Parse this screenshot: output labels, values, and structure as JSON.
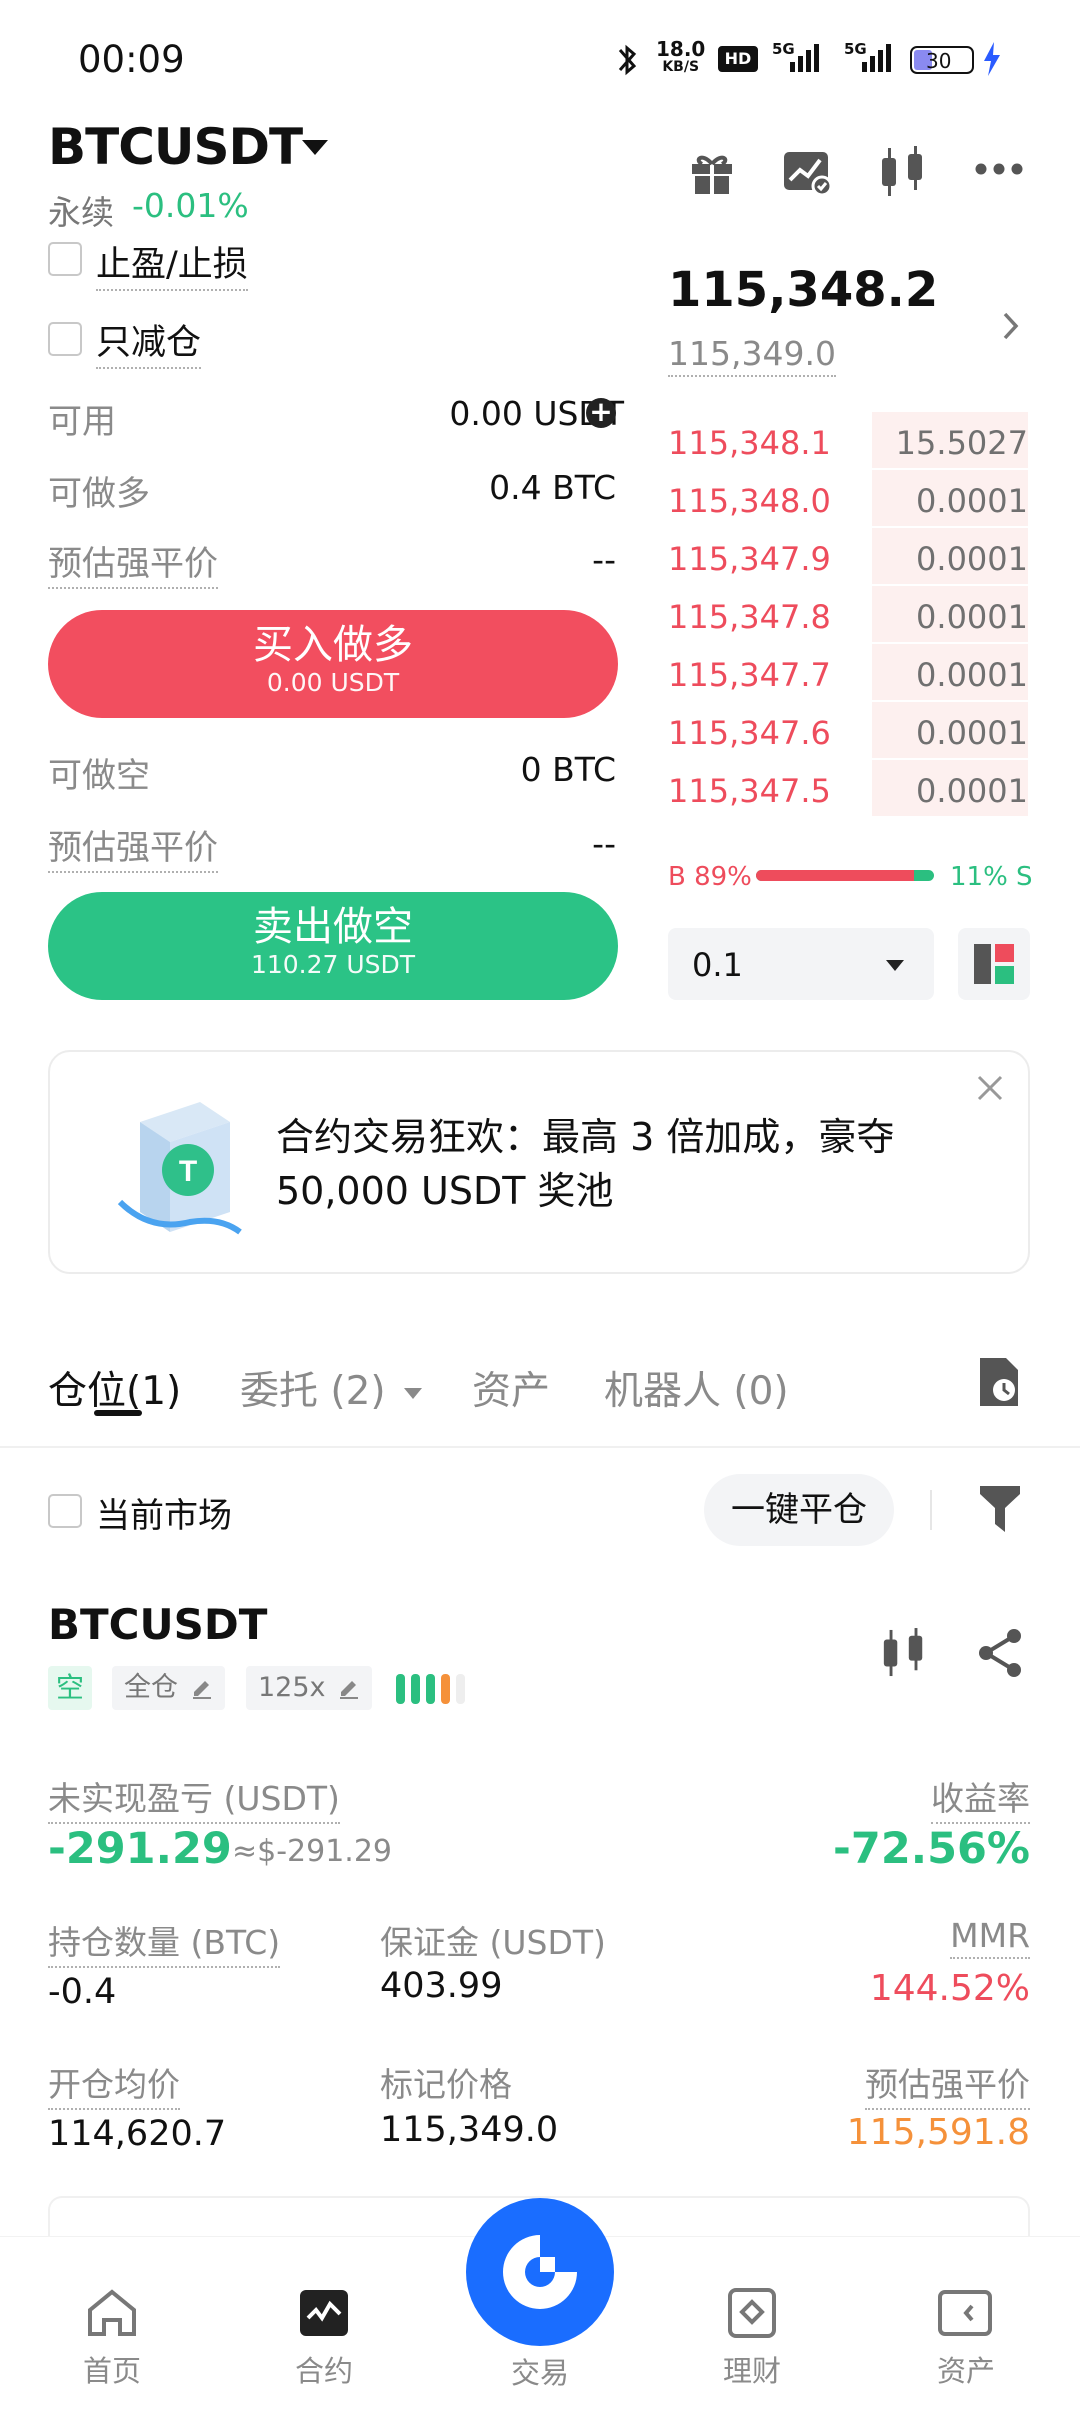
{
  "status_bar": {
    "time": "00:09",
    "net_speed": "18.0",
    "net_unit": "KB/S",
    "hd": "HD",
    "sig1": "5G",
    "sig2": "5G",
    "battery": "30"
  },
  "header": {
    "pair": "BTCUSDT",
    "perp_label": "永续",
    "change": "-0.01%",
    "icons": [
      "gift-icon",
      "chart-icon",
      "candlestick-icon",
      "more-icon"
    ]
  },
  "order_form": {
    "tp_sl_label": "止盈/止损",
    "reduce_only_label": "只减仓",
    "available_label": "可用",
    "available_value": "0.00",
    "available_unit": "USDT",
    "can_long_label": "可做多",
    "can_long_value": "0.4 BTC",
    "liq_label_1": "预估强平价",
    "liq_value_1": "--",
    "buy_label": "买入做多",
    "buy_amount": "0.00 USDT",
    "can_short_label": "可做空",
    "can_short_value": "0 BTC",
    "liq_label_2": "预估强平价",
    "liq_value_2": "--",
    "sell_label": "卖出做空",
    "sell_amount": "110.27 USDT"
  },
  "order_book": {
    "last_price": "115,348.2",
    "mark_price": "115,349.0",
    "asks": [
      {
        "price": "115,348.1",
        "qty": "15.5027"
      },
      {
        "price": "115,348.0",
        "qty": "0.0001"
      },
      {
        "price": "115,347.9",
        "qty": "0.0001"
      },
      {
        "price": "115,347.8",
        "qty": "0.0001"
      },
      {
        "price": "115,347.7",
        "qty": "0.0001"
      },
      {
        "price": "115,347.6",
        "qty": "0.0001"
      },
      {
        "price": "115,347.5",
        "qty": "0.0001"
      }
    ],
    "buy_ratio_label": "B 89%",
    "sell_ratio_label": "11% S",
    "buy_ratio": 0.89,
    "precision_value": "0.1"
  },
  "banner": {
    "text_line1": "合约交易狂欢：最高 3 倍加成，豪夺",
    "text_line2": "50,000 USDT 奖池"
  },
  "tabs": {
    "positions": "仓位",
    "positions_count": "(1)",
    "orders": "委托 (2)",
    "assets": "资产",
    "bots": "机器人 (0)"
  },
  "filter": {
    "current_market_label": "当前市场",
    "close_all_label": "一键平仓"
  },
  "position": {
    "symbol": "BTCUSDT",
    "side_tag": "空",
    "margin_mode": "全仓",
    "leverage": "125x",
    "upnl_label": "未实现盈亏 (USDT)",
    "upnl_value": "-291.29",
    "upnl_usd": "≈$-291.29",
    "roe_label": "收益率",
    "roe_value": "-72.56%",
    "size_label": "持仓数量 (BTC)",
    "size_value": "-0.4",
    "margin_label": "保证金 (USDT)",
    "margin_value": "403.99",
    "mmr_label": "MMR",
    "mmr_value": "144.52%",
    "entry_label": "开仓均价",
    "entry_value": "114,620.7",
    "mark_label": "标记价格",
    "mark_value": "115,349.0",
    "liq_label": "预估强平价",
    "liq_value": "115,591.8"
  },
  "bottom_nav": {
    "home": "首页",
    "futures": "合约",
    "trade": "交易",
    "earn": "理财",
    "assets": "资产"
  },
  "colors": {
    "green": "#2bbf80",
    "red": "#ee4c5c",
    "orange": "#f5913a",
    "blue": "#1a6dff"
  }
}
